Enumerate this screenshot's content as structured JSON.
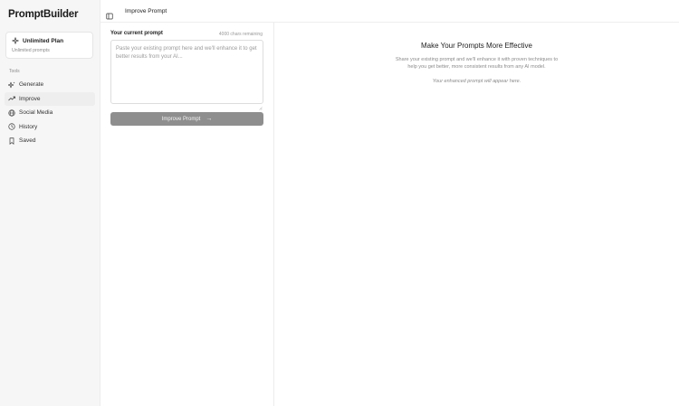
{
  "sidebar": {
    "brand": "PromptBuilder",
    "plan": {
      "title": "Unlimited Plan",
      "subtitle": "Unlimited prompts"
    },
    "section_label": "Tools",
    "items": [
      {
        "label": "Generate",
        "icon": "sparkles-icon"
      },
      {
        "label": "Improve",
        "icon": "trending-up-icon",
        "active": true
      },
      {
        "label": "Social Media",
        "icon": "globe-icon"
      },
      {
        "label": "History",
        "icon": "clock-icon"
      },
      {
        "label": "Saved",
        "icon": "bookmark-icon"
      }
    ]
  },
  "header": {
    "title": "Improve Prompt",
    "toggle_icon": "sidebar-toggle-icon"
  },
  "form": {
    "label": "Your current prompt",
    "char_count": "4000 chars remaining",
    "placeholder": "Paste your existing prompt here and we'll enhance it to get better results from your AI...",
    "value": "",
    "button_label": "Improve Prompt",
    "button_icon": "arrow-right-icon"
  },
  "empty_state": {
    "title": "Make Your Prompts More Effective",
    "description": "Share your existing prompt and we'll enhance it with proven techniques to help you get better, more consistent results from any AI model.",
    "note": "Your enhanced prompt will appear here."
  },
  "colors": {
    "sidebar_bg": "#f6f6f6",
    "button_bg": "#8e8e8e",
    "active_item_bg": "#eeeeee"
  }
}
